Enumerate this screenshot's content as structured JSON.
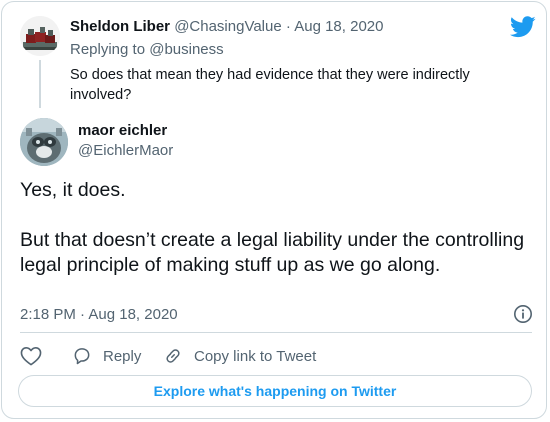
{
  "parent_tweet": {
    "author_name": "Sheldon Liber",
    "author_handle": "@ChasingValue",
    "separator": "·",
    "date": "Aug 18, 2020",
    "replying_prefix": "Replying to",
    "replying_to": "@business",
    "text": "So does that mean they had evidence that they were indirectly involved?"
  },
  "main_tweet": {
    "author_name": "maor eichler",
    "author_handle": "@EichlerMaor",
    "paragraphs": [
      "Yes, it does.",
      "But that doesn’t create a legal liability under the controlling legal principle of making stuff up as we go along."
    ],
    "time": "2:18 PM",
    "separator": "·",
    "date": "Aug 18, 2020"
  },
  "actions": {
    "like_icon": "heart-icon",
    "reply_label": "Reply",
    "reply_icon": "reply-bubble-icon",
    "copy_link_label": "Copy link to Tweet",
    "copy_link_icon": "link-icon"
  },
  "footer": {
    "explore_label": "Explore what's happening on Twitter"
  },
  "colors": {
    "brand": "#1d9bf0",
    "text": "#0f1419",
    "secondary": "#536471",
    "border": "#cfd9de"
  }
}
